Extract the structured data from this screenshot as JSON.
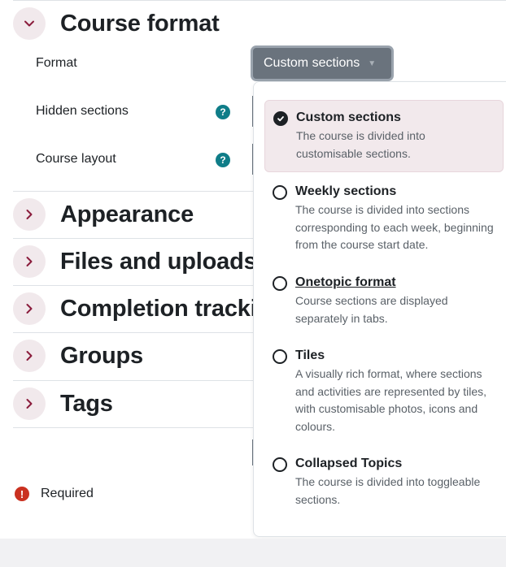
{
  "sections": {
    "course_format": {
      "title": "Course format",
      "expanded": true
    },
    "appearance": {
      "title": "Appearance"
    },
    "files_uploads": {
      "title": "Files and uploads"
    },
    "completion": {
      "title": "Completion tracking"
    },
    "groups": {
      "title": "Groups"
    },
    "tags": {
      "title": "Tags"
    }
  },
  "form": {
    "format_label": "Format",
    "hidden_sections_label": "Hidden sections",
    "course_layout_label": "Course layout",
    "help_glyph": "?",
    "format_value": "Custom sections"
  },
  "dropdown": {
    "options": [
      {
        "title": "Custom sections",
        "desc": "The course is divided into customisable sections.",
        "selected": true
      },
      {
        "title": "Weekly sections",
        "desc": "The course is divided into sections corresponding to each week, beginning from the course start date.",
        "selected": false
      },
      {
        "title": "Onetopic format",
        "desc": "Course sections are displayed separately in tabs.",
        "selected": false
      },
      {
        "title": "Tiles",
        "desc": "A visually rich format, where sections and activities are represented by tiles, with customisable photos, icons and colours.",
        "selected": false
      },
      {
        "title": "Collapsed Topics",
        "desc": "The course is divided into toggleable sections.",
        "selected": false
      }
    ]
  },
  "required": {
    "glyph": "!",
    "label": "Required"
  },
  "icons": {
    "chevron_down": "chevron-down-icon",
    "chevron_right": "chevron-right-icon",
    "help": "question-circle-icon",
    "required": "exclamation-circle-icon",
    "check": "check-icon"
  },
  "colors": {
    "accent_maroon": "#8a1c3c",
    "help_teal": "#0f7d88",
    "select_bg": "#6a737d",
    "required_red": "#ca3120",
    "selected_option_bg": "#f2e9ec"
  }
}
